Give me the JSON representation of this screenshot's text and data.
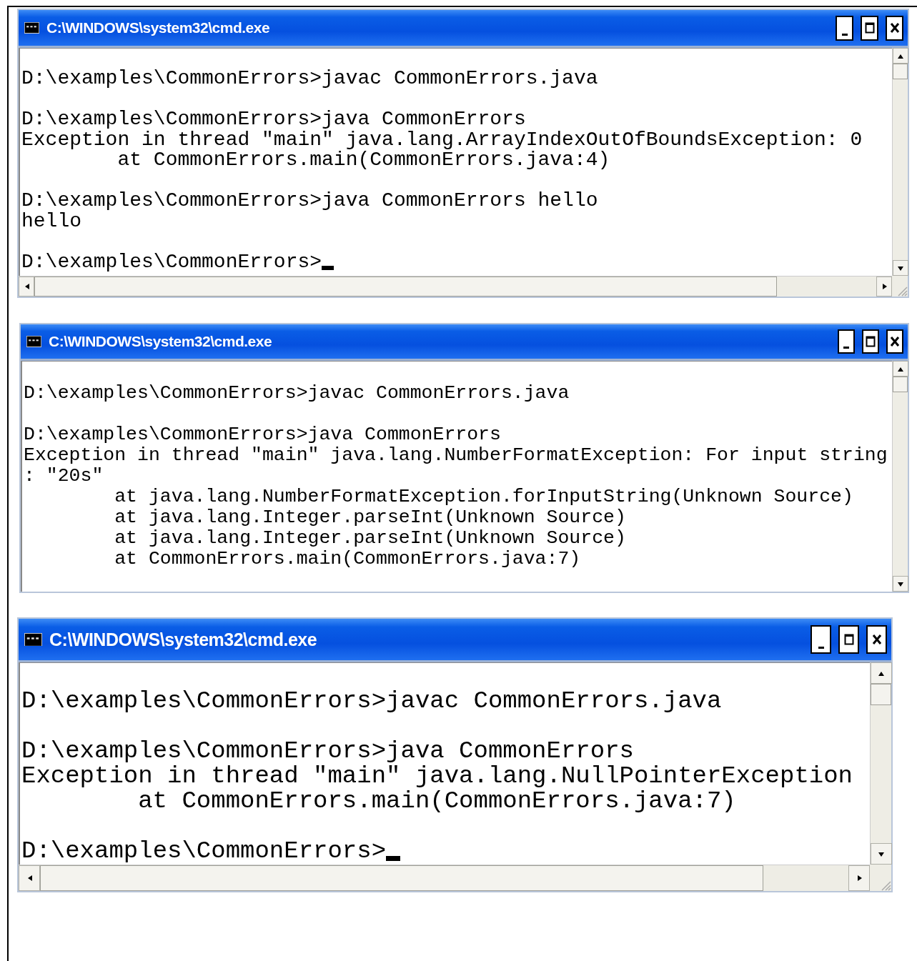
{
  "windows": [
    {
      "title": "C:\\WINDOWS\\system32\\cmd.exe",
      "horizontal_scrollbar": true,
      "cursor_visible": true,
      "blocks": [
        {
          "lines": [
            {
              "text": "D:\\examples\\CommonErrors>javac CommonErrors.java",
              "indented": false
            }
          ]
        },
        {
          "lines": [
            {
              "text": "D:\\examples\\CommonErrors>java CommonErrors",
              "indented": false
            },
            {
              "text": "Exception in thread \"main\" java.lang.ArrayIndexOutOfBoundsException: 0",
              "indented": false
            },
            {
              "text": "at CommonErrors.main(CommonErrors.java:4)",
              "indented": true
            }
          ]
        },
        {
          "lines": [
            {
              "text": "D:\\examples\\CommonErrors>java CommonErrors hello",
              "indented": false
            },
            {
              "text": "hello",
              "indented": false
            }
          ]
        },
        {
          "lines": [
            {
              "text": "D:\\examples\\CommonErrors>",
              "indented": false
            }
          ]
        }
      ]
    },
    {
      "title": "C:\\WINDOWS\\system32\\cmd.exe",
      "horizontal_scrollbar": false,
      "cursor_visible": false,
      "blocks": [
        {
          "lines": [
            {
              "text": "D:\\examples\\CommonErrors>javac CommonErrors.java",
              "indented": false
            }
          ]
        },
        {
          "lines": [
            {
              "text": "D:\\examples\\CommonErrors>java CommonErrors",
              "indented": false
            },
            {
              "text": "Exception in thread \"main\" java.lang.NumberFormatException: For input string",
              "indented": false
            },
            {
              "text": ": \"20s\"",
              "indented": false
            },
            {
              "text": "at java.lang.NumberFormatException.forInputString(Unknown Source)",
              "indented": true
            },
            {
              "text": "at java.lang.Integer.parseInt(Unknown Source)",
              "indented": true
            },
            {
              "text": "at java.lang.Integer.parseInt(Unknown Source)",
              "indented": true
            },
            {
              "text": "at CommonErrors.main(CommonErrors.java:7)",
              "indented": true
            }
          ]
        }
      ]
    },
    {
      "title": "C:\\WINDOWS\\system32\\cmd.exe",
      "horizontal_scrollbar": true,
      "cursor_visible": true,
      "blocks": [
        {
          "lines": [
            {
              "text": "D:\\examples\\CommonErrors>javac CommonErrors.java",
              "indented": false
            }
          ]
        },
        {
          "lines": [
            {
              "text": "D:\\examples\\CommonErrors>java CommonErrors",
              "indented": false
            },
            {
              "text": "Exception in thread \"main\" java.lang.NullPointerException",
              "indented": false
            },
            {
              "text": "at CommonErrors.main(CommonErrors.java:7)",
              "indented": true
            }
          ]
        },
        {
          "lines": [
            {
              "text": "D:\\examples\\CommonErrors>",
              "indented": false
            }
          ]
        }
      ]
    }
  ]
}
